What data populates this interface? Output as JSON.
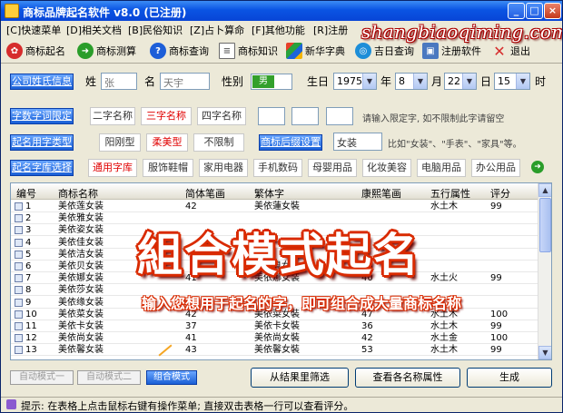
{
  "window": {
    "title": "商标品牌起名软件 v8.0 (已注册)",
    "controls": {
      "minimize": "_",
      "maximize": "□",
      "close": "×"
    }
  },
  "menu": [
    "[C]快速菜单",
    "[D]相关文档",
    "[B]民俗知识",
    "[Z]占卜算命",
    "[F]其他功能",
    "[R]注册"
  ],
  "watermark": "shangbiaoqiming.com",
  "toolbar": [
    {
      "label": "商标起名",
      "icon": "flower-icon",
      "color": "#d62c2c"
    },
    {
      "label": "商标测算",
      "icon": "arrow-right-icon",
      "color": "#2a9d2a"
    },
    {
      "label": "商标查询",
      "icon": "question-icon",
      "color": "#1d5ed8"
    },
    {
      "label": "商标知识",
      "icon": "document-icon",
      "color": "#6a6a6a"
    },
    {
      "label": "新华字典",
      "icon": "windows-icon",
      "color": "#e48a00"
    },
    {
      "label": "吉日查询",
      "icon": "globe-icon",
      "color": "#1d8ed8"
    },
    {
      "label": "注册软件",
      "icon": "computer-icon",
      "color": "#4a78c0"
    },
    {
      "label": "退出",
      "icon": "close-icon",
      "color": "#d62c2c"
    }
  ],
  "info": {
    "button": "公司姓氏信息",
    "surname_label": "姓",
    "surname_value": "张",
    "name_label": "名",
    "name_value": "天宇",
    "gender_label": "性别",
    "gender_value": "男",
    "birthday_label": "生日",
    "year": "1975",
    "year_unit": "年",
    "month": "8",
    "month_unit": "月",
    "day": "22",
    "day_unit": "日",
    "hour": "15",
    "hour_unit": "时"
  },
  "limit": {
    "button": "字数字词限定",
    "options": [
      "二字名称",
      "三字名称",
      "四字名称"
    ],
    "selected": "三字名称",
    "hint": "请输入限定字, 如不限制此字请留空"
  },
  "type": {
    "button": "起名用字类型",
    "options": [
      "阳刚型",
      "柔美型",
      "不限制"
    ],
    "selected": "柔美型",
    "suffix_button": "商标后缀设置",
    "suffix_value": "女装",
    "hint": "比如\"女装\"、\"手表\"、\"家具\"等。"
  },
  "library": {
    "button": "起名字库选择",
    "options": [
      "通用字库",
      "服饰鞋帽",
      "家用电器",
      "手机数码",
      "母婴用品",
      "化妆美容",
      "电脑用品",
      "办公用品"
    ],
    "selected": "通用字库"
  },
  "table": {
    "columns": [
      "编号",
      "商标名称",
      "简体笔画",
      "繁体字",
      "康熙笔画",
      "五行属性",
      "评分"
    ],
    "rows": [
      [
        "1",
        "美依莲女装",
        "42",
        "美依蓮女裝",
        "",
        "水土木",
        "99"
      ],
      [
        "2",
        "美依雅女装",
        "",
        "",
        "",
        "",
        ""
      ],
      [
        "3",
        "美依姿女装",
        "",
        "",
        "",
        "",
        ""
      ],
      [
        "4",
        "美依佳女装",
        "",
        "",
        "",
        "",
        ""
      ],
      [
        "5",
        "美依洁女装",
        "",
        "",
        "",
        "",
        ""
      ],
      [
        "6",
        "美依贝女装",
        "",
        "美依貝女",
        "43",
        "",
        ""
      ],
      [
        "7",
        "美依娜女装",
        "41",
        "美依娜女装",
        "40",
        "水土火",
        "99"
      ],
      [
        "8",
        "美依莎女装",
        "",
        "",
        "",
        "",
        ""
      ],
      [
        "9",
        "美依缘女装",
        "",
        "",
        "",
        "",
        ""
      ],
      [
        "10",
        "美依菜女装",
        "42",
        "美依菜女裝",
        "47",
        "水土木",
        "100"
      ],
      [
        "11",
        "美依卡女装",
        "37",
        "美依卡女裝",
        "36",
        "水土木",
        "99"
      ],
      [
        "12",
        "美依尚女装",
        "41",
        "美依尚女裝",
        "42",
        "水土金",
        "100"
      ],
      [
        "13",
        "美依馨女装",
        "43",
        "美依馨女裝",
        "53",
        "水土木",
        "99"
      ]
    ]
  },
  "overlay": {
    "headline": "組合模式起名",
    "subline": "输入您想用于起名的字，即可组合成大量商标名称"
  },
  "modes": [
    "自动模式一",
    "自动模式二",
    "组合模式"
  ],
  "active_mode": "组合模式",
  "actions": [
    "从结果里筛选",
    "查看各名称属性",
    "生成"
  ],
  "status": "提示: 在表格上点击鼠标右键有操作菜单; 直接双击表格一行可以查看评分。"
}
